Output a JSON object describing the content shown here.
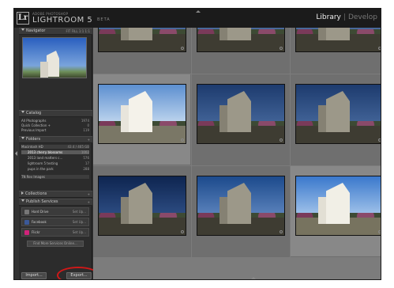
{
  "app": {
    "brand_small": "ADOBE PHOTOSHOP",
    "brand_name": "LIGHTROOM 5",
    "brand_version": "BETA",
    "logo": "Lr",
    "modules": [
      "Library",
      "Develop"
    ],
    "active_module": "Library"
  },
  "left_panel": {
    "navigator": {
      "title": "Navigator",
      "zoom_options": "FIT  FILL  1:1  1:1"
    },
    "catalog": {
      "title": "Catalog",
      "items": [
        {
          "label": "All Photographs",
          "count": "1974"
        },
        {
          "label": "Quick Collection +",
          "count": "0"
        },
        {
          "label": "Previous Import",
          "count": "119"
        }
      ]
    },
    "folders": {
      "title": "Folders",
      "drive": {
        "label": "Macintosh HD",
        "info": "43.4 / 465 GB"
      },
      "items": [
        {
          "label": "2013 cherry blossoms",
          "count": "1002",
          "selected": true
        },
        {
          "label": "2013 land matters c...",
          "count": "576"
        },
        {
          "label": "lightroom 5 testing",
          "count": "17"
        },
        {
          "label": "pups in the park",
          "count": "288"
        }
      ],
      "drive2": {
        "label": "TN Rev Images"
      }
    },
    "collections": {
      "title": "Collections"
    },
    "publish_services": {
      "title": "Publish Services",
      "items": [
        {
          "label": "Hard Drive",
          "action": "Set Up...",
          "icon_color": "#777777"
        },
        {
          "label": "Facebook",
          "action": "Set Up...",
          "icon_color": "#3b5998"
        },
        {
          "label": "Flickr",
          "action": "Set Up...",
          "icon_color": "#d0237a"
        }
      ],
      "find_more": "Find More Services Online..."
    },
    "import_label": "Import...",
    "export_label": "Export...",
    "highlight_color": "#d01818"
  },
  "grid": {
    "cells": [
      {
        "number": "",
        "lighting": "dim"
      },
      {
        "number": "",
        "lighting": "dim"
      },
      {
        "number": "",
        "lighting": "dim"
      },
      {
        "number": "73",
        "lighting": "bright"
      },
      {
        "number": "74",
        "lighting": "dark"
      },
      {
        "number": "75",
        "lighting": "dark"
      },
      {
        "number": "77",
        "lighting": "dark"
      },
      {
        "number": "78",
        "lighting": "dark"
      },
      {
        "number": "79",
        "lighting": "bright"
      }
    ]
  }
}
